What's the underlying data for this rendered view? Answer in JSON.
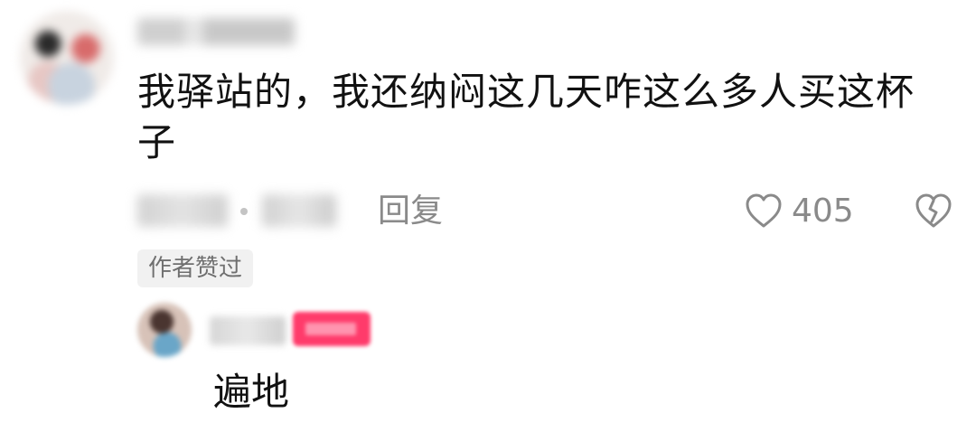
{
  "comment": {
    "text": "我驿站的，我还纳闷这几天咋这么多人买这杯子",
    "reply_label": "回复",
    "like_count": "405",
    "author_liked_badge": "作者赞过"
  },
  "reply": {
    "text": "遍地"
  },
  "icons": {
    "like": "heart-outline-icon",
    "dislike": "broken-heart-outline-icon"
  },
  "colors": {
    "text_primary": "#111111",
    "text_secondary": "#8a8a8a",
    "badge_background": "#f1f1f1",
    "author_tag": "#ff3b6b"
  }
}
